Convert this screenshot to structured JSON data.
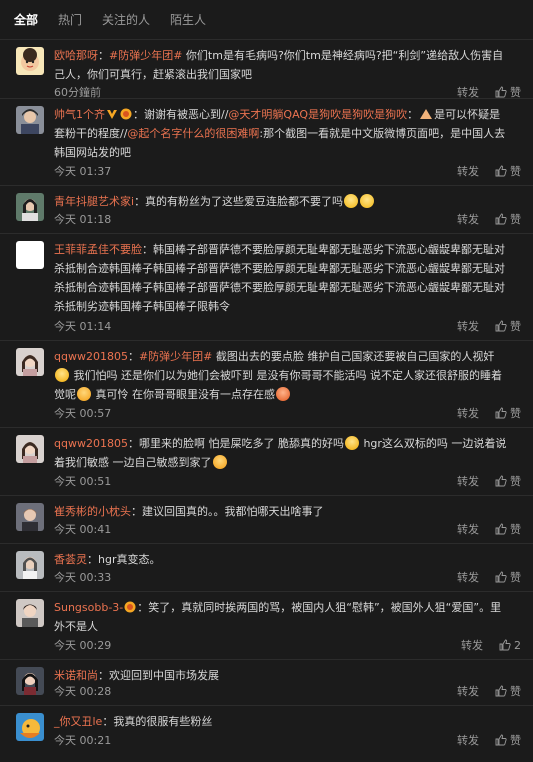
{
  "tabs": [
    {
      "label": "全部",
      "active": true
    },
    {
      "label": "热门",
      "active": false
    },
    {
      "label": "关注的人",
      "active": false
    },
    {
      "label": "陌生人",
      "active": false
    }
  ],
  "actions": {
    "repost": "转发",
    "like": "赞"
  },
  "comments": [
    {
      "user": "欧哈那呀",
      "segments": [
        {
          "t": "：",
          "c": ""
        },
        {
          "t": "#防弹少年团#",
          "c": "topic"
        },
        {
          "t": " 你们tm是有毛病吗?你们tm是神经病吗?把“利剑”递给敌人伤害自己人，你们可真行，赶紧滚出我们国家吧",
          "c": ""
        }
      ],
      "time": "60分鐘前",
      "likes": ""
    },
    {
      "user": "帅气1个齐",
      "segments": [
        {
          "t": "：谢谢有被恶心到//",
          "c": ""
        },
        {
          "t": "@天才明躺QAQ是狗吹是狗吹是狗吹",
          "c": "mention"
        },
        {
          "t": "：",
          "c": ""
        },
        {
          "t": "是可以怀疑是套粉干的程度//",
          "c": ""
        },
        {
          "t": "@起个名字什么的很困难啊",
          "c": "mention"
        },
        {
          "t": ":那个截图一看就是中文版微博页面吧，是中国人去韩国网站发的吧",
          "c": ""
        }
      ],
      "time": "今天 01:37",
      "likes": ""
    },
    {
      "user": "青年抖腿艺术家i",
      "segments": [
        {
          "t": "：真的有粉丝为了这些爱豆连脸都不要了吗",
          "c": ""
        }
      ],
      "time": "今天 01:18",
      "likes": ""
    },
    {
      "user": "王菲菲孟佳不要脸",
      "segments": [
        {
          "t": "：韩国棒子部晋萨德不要脸厚颜无耻卑鄙无耻恶劣下流恶心龌龊卑鄙无耻对杀抵制合迹韩国棒子韩国棒子部晋萨德不要脸厚颜无耻卑鄙无耻恶劣下流恶心龌龊卑鄙无耻对杀抵制合迹韩国棒子韩国棒子部晋萨德不要脸厚颜无耻卑鄙无耻恶劣下流恶心龌龊卑鄙无耻对杀抵制劣迹韩国棒子韩国棒子限韩令",
          "c": ""
        }
      ],
      "time": "今天 01:14",
      "likes": ""
    },
    {
      "user": "qqww201805",
      "segments": [
        {
          "t": "：",
          "c": ""
        },
        {
          "t": "#防弹少年团#",
          "c": "topic"
        },
        {
          "t": " 截图出去的要点脸 维护自己国家还要被自己国家的人视奸",
          "c": ""
        },
        {
          "t": " 我们怕吗 还是你们以为她们会被吓到 是没有你哥哥不能活吗 说不定人家还很舒服的睡着觉呢",
          "c": ""
        },
        {
          "t": " 真可怜 在你哥哥眼里没有一点存在感",
          "c": ""
        }
      ],
      "time": "今天 00:57",
      "likes": ""
    },
    {
      "user": "qqww201805",
      "segments": [
        {
          "t": "：哪里来的脸啊 怕是屎吃多了 脆舔真的好吗",
          "c": ""
        },
        {
          "t": " hgr这么双标的吗 一边说着说着我们敏感 一边自己敏感到家了",
          "c": ""
        }
      ],
      "time": "今天 00:51",
      "likes": ""
    },
    {
      "user": "崔秀彬的小枕头",
      "segments": [
        {
          "t": "：建议回国真的。。我都怕哪天出啥事了",
          "c": ""
        }
      ],
      "time": "今天 00:41",
      "likes": ""
    },
    {
      "user": "香荟灵",
      "segments": [
        {
          "t": "：hgr真变态。",
          "c": ""
        }
      ],
      "time": "今天 00:33",
      "likes": ""
    },
    {
      "user": "Sungsobb-3-",
      "segments": [
        {
          "t": "：笑了，真就同时挨两国的骂，被国内人狙“慰韩”，被国外人狙“爱国”。里外不是人",
          "c": ""
        }
      ],
      "time": "今天 00:29",
      "likes": "2"
    },
    {
      "user": "米诺和尚",
      "segments": [
        {
          "t": "：欢迎回到中国市场发展",
          "c": ""
        }
      ],
      "time": "今天 00:28",
      "likes": ""
    },
    {
      "user": "_你又丑le",
      "segments": [
        {
          "t": "：我真的很服有些粉丝",
          "c": ""
        }
      ],
      "time": "今天 00:21",
      "likes": ""
    }
  ]
}
